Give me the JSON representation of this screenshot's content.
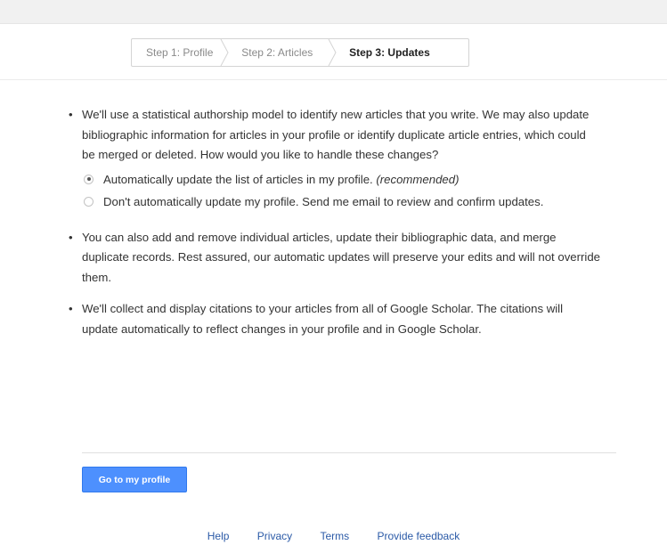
{
  "steps": {
    "step1": "Step 1: Profile",
    "step2": "Step 2: Articles",
    "step3": "Step 3: Updates"
  },
  "content": {
    "bullet1": "We'll use a statistical authorship model to identify new articles that you write. We may also update bibliographic information for articles in your profile or identify duplicate article entries, which could be merged or deleted. How would you like to handle these changes?",
    "option_auto": "Automatically update the list of articles in my profile.",
    "option_auto_note": "(recommended)",
    "option_manual": "Don't automatically update my profile. Send me email to review and confirm updates.",
    "selected_option": "auto",
    "bullet2": "You can also add and remove individual articles, update their bibliographic data, and merge duplicate records. Rest assured, our automatic updates will preserve your edits and will not override them.",
    "bullet3": "We'll collect and display citations to your articles from all of Google Scholar. The citations will update automatically to reflect changes in your profile and in Google Scholar."
  },
  "actions": {
    "go_to_profile": "Go to my profile"
  },
  "footer": {
    "help": "Help",
    "privacy": "Privacy",
    "terms": "Terms",
    "feedback": "Provide feedback"
  },
  "colors": {
    "button_blue": "#4d90fe",
    "link_blue": "#2b5aa7"
  }
}
